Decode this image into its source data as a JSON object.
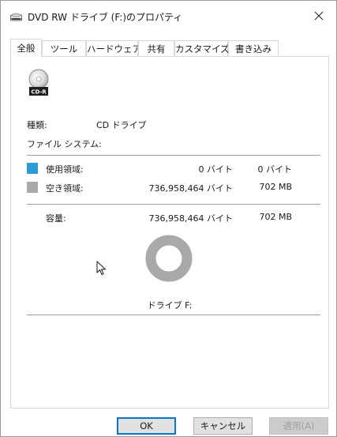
{
  "window": {
    "title": "DVD RW ドライブ (F:)のプロパティ",
    "close_label": "×"
  },
  "tabs": [
    {
      "label": "全般",
      "active": true
    },
    {
      "label": "ツール",
      "active": false
    },
    {
      "label": "ハードウェア",
      "active": false
    },
    {
      "label": "共有",
      "active": false
    },
    {
      "label": "カスタマイズ",
      "active": false
    },
    {
      "label": "書き込み",
      "active": false
    }
  ],
  "drive": {
    "icon_label": "CD-R",
    "type_label": "種類:",
    "type_value": "CD ドライブ",
    "filesystem_label": "ファイル システム:",
    "filesystem_value": ""
  },
  "usage": {
    "used": {
      "label": "使用領域:",
      "bytes": "0 バイト",
      "size": "0 バイト",
      "color": "#2a9bd8"
    },
    "free": {
      "label": "空き領域:",
      "bytes": "736,958,464 バイト",
      "size": "702 MB",
      "color": "#a9a9a9"
    },
    "capacity": {
      "label": "容量:",
      "bytes": "736,958,464 バイト",
      "size": "702 MB"
    },
    "used_fraction": 0.0
  },
  "drive_label": "ドライブ F:",
  "buttons": {
    "ok": "OK",
    "cancel": "キャンセル",
    "apply": "適用(A)"
  }
}
